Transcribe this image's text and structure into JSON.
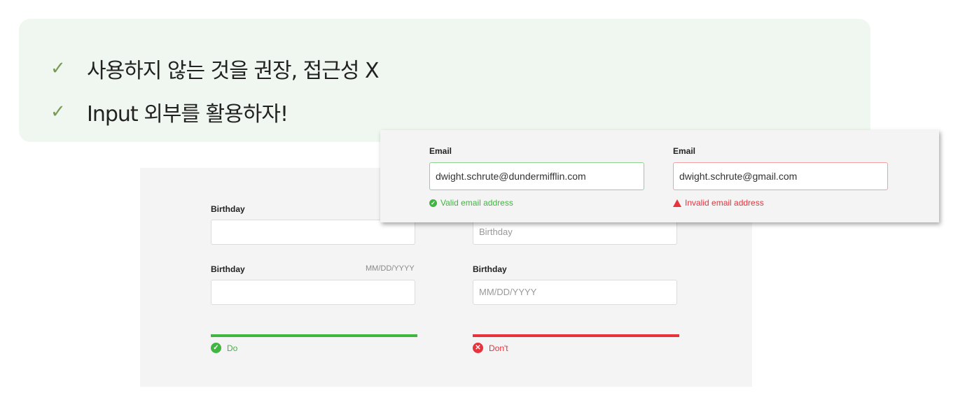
{
  "callout": {
    "bullets": [
      {
        "text": "사용하지 않는 것을 권장, 접근성 X"
      },
      {
        "text": "Input 외부를 활용하자!"
      }
    ]
  },
  "panel": {
    "do_column": {
      "field1_label": "Birthday",
      "field2_label": "Birthday",
      "field2_hint": "MM/DD/YYYY",
      "result_label": "Do",
      "color": "#3fb63f"
    },
    "dont_column": {
      "field1_placeholder": "Birthday",
      "field2_label": "Birthday",
      "field2_placeholder": "MM/DD/YYYY",
      "result_label": "Don't",
      "color": "#e8323c"
    }
  },
  "email_card": {
    "valid": {
      "label": "Email",
      "value": "dwight.schrute@dundermifflin.com",
      "message": "Valid email address",
      "color": "#3fb63f"
    },
    "invalid": {
      "label": "Email",
      "value": "dwight.schrute@gmail.com",
      "message": "Invalid email address",
      "color": "#e8323c"
    }
  }
}
